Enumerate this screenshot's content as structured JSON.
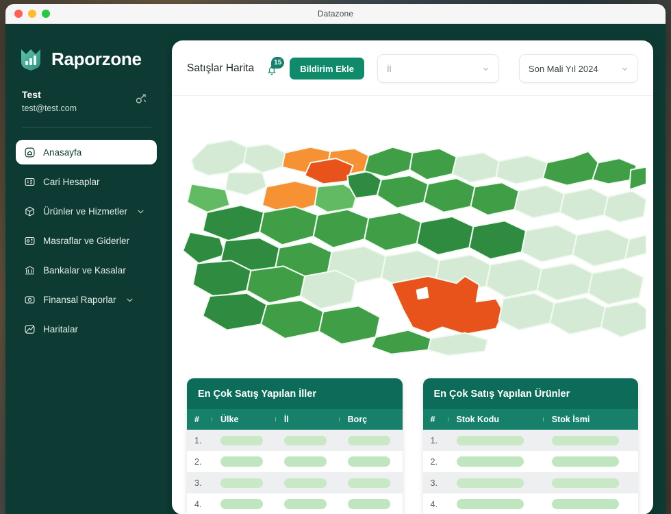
{
  "window": {
    "title": "Datazone",
    "traffic_lights": [
      "close-button",
      "minimize-button",
      "maximize-button"
    ]
  },
  "sidebar": {
    "brand": {
      "name": "Raporzone",
      "logo_icon": "chart-shield-logo"
    },
    "user": {
      "name": "Test",
      "email": "test@test.com",
      "action_icon": "share-nodes-icon"
    },
    "items": [
      {
        "label": "Anasayfa",
        "icon": "home-icon",
        "active": true,
        "expandable": false
      },
      {
        "label": "Cari Hesaplar",
        "icon": "id-card-icon",
        "active": false,
        "expandable": false
      },
      {
        "label": "Ürünler ve Hizmetler",
        "icon": "box-icon",
        "active": false,
        "expandable": true
      },
      {
        "label": "Masraflar ve Giderler",
        "icon": "receipt-icon",
        "active": false,
        "expandable": false
      },
      {
        "label": "Bankalar ve Kasalar",
        "icon": "bank-icon",
        "active": false,
        "expandable": false
      },
      {
        "label": "Finansal Raporlar",
        "icon": "report-icon",
        "active": false,
        "expandable": true
      },
      {
        "label": "Haritalar",
        "icon": "map-icon",
        "active": false,
        "expandable": false
      }
    ]
  },
  "header": {
    "page_title": "Satışlar Harita",
    "notification": {
      "icon": "bell-icon",
      "badge_count": "15"
    },
    "add_notification_label": "Bildirim Ekle",
    "province_select": {
      "value": "İl",
      "is_placeholder": true,
      "caret_icon": "chevron-down-icon"
    },
    "period_select": {
      "value": "Son Mali Yıl 2024",
      "is_placeholder": false,
      "caret_icon": "chevron-down-icon"
    }
  },
  "map": {
    "name": "turkey-provinces-choropleth",
    "colors": {
      "pale": "#d5ead5",
      "light": "#bfe3bd",
      "medium": "#62bb63",
      "dark": "#3f9e46",
      "deep": "#2e8b3f",
      "orange": "#f79234",
      "red": "#e8531c",
      "border": "#f2faf2",
      "background": "#ffffff"
    }
  },
  "tables": [
    {
      "title": "En Çok Satış Yapılan İller",
      "columns": [
        "#",
        "Ülke",
        "İl",
        "Borç"
      ],
      "rows": [
        {
          "index": "1.",
          "loading": true
        },
        {
          "index": "2.",
          "loading": true
        },
        {
          "index": "3.",
          "loading": true
        },
        {
          "index": "4.",
          "loading": true
        }
      ]
    },
    {
      "title": "En Çok Satış Yapılan Ürünler",
      "columns": [
        "#",
        "Stok Kodu",
        "Stok İsmi"
      ],
      "rows": [
        {
          "index": "1.",
          "loading": true
        },
        {
          "index": "2.",
          "loading": true
        },
        {
          "index": "3.",
          "loading": true
        },
        {
          "index": "4.",
          "loading": true
        }
      ]
    }
  ],
  "theme": {
    "sidebar_bg": "#0d3b33",
    "accent": "#0f8a6a",
    "table_title_bg": "#0d6b5a",
    "table_head_bg": "#17806b",
    "skeleton": "#bfe6bf"
  }
}
